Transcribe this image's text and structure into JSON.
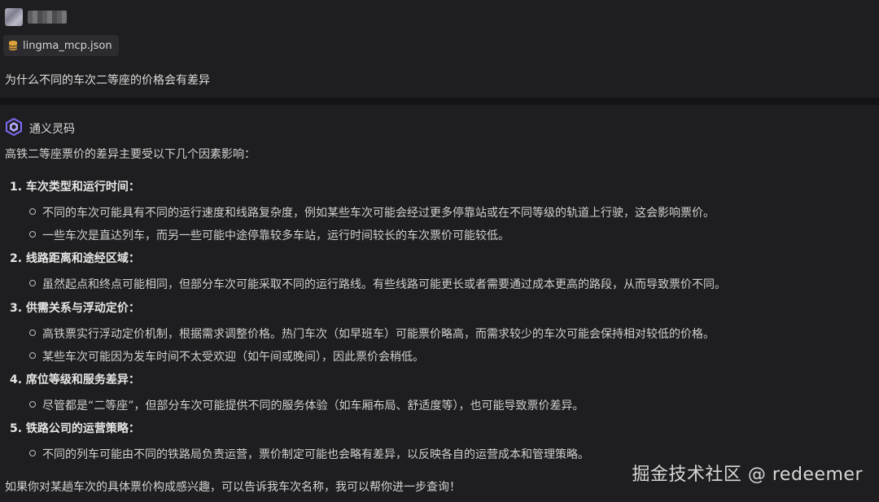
{
  "user": {
    "file_attachment": "lingma_mcp.json",
    "question": "为什么不同的车次二等座的价格会有差异"
  },
  "assistant": {
    "name": "通义灵码",
    "intro": "高铁二等座票价的差异主要受以下几个因素影响：",
    "sections": [
      {
        "title": "1. 车次类型和运行时间：",
        "bullets": [
          "不同的车次可能具有不同的运行速度和线路复杂度，例如某些车次可能会经过更多停靠站或在不同等级的轨道上行驶，这会影响票价。",
          "一些车次是直达列车，而另一些可能中途停靠较多车站，运行时间较长的车次票价可能较低。"
        ]
      },
      {
        "title": "2. 线路距离和途经区域：",
        "bullets": [
          "虽然起点和终点可能相同，但部分车次可能采取不同的运行路线。有些线路可能更长或者需要通过成本更高的路段，从而导致票价不同。"
        ]
      },
      {
        "title": "3. 供需关系与浮动定价：",
        "bullets": [
          "高铁票实行浮动定价机制，根据需求调整价格。热门车次（如早班车）可能票价略高，而需求较少的车次可能会保持相对较低的价格。",
          "某些车次可能因为发车时间不太受欢迎（如午间或晚间），因此票价会稍低。"
        ]
      },
      {
        "title": "4. 席位等级和服务差异：",
        "bullets": [
          "尽管都是“二等座”，但部分车次可能提供不同的服务体验（如车厢布局、舒适度等），也可能导致票价差异。"
        ]
      },
      {
        "title": "5. 铁路公司的运营策略：",
        "bullets": [
          "不同的列车可能由不同的铁路局负责运营，票价制定可能也会略有差异，以反映各自的运营成本和管理策略。"
        ]
      }
    ],
    "closing": "如果你对某趟车次的具体票价构成感兴趣，可以告诉我车次名称，我可以帮你进一步查询！"
  },
  "watermark": "掘金技术社区 @ redeemer",
  "colors": {
    "background": "#1e1e20",
    "divider": "#141416",
    "chip": "#2c2c30",
    "file_icon": "#e0a23a",
    "logo_primary": "#7b6cf6",
    "logo_secondary": "#b6a8ff"
  },
  "icons": {
    "file": "database-file-icon",
    "assistant_logo": "tongyi-lingma-logo-icon"
  }
}
